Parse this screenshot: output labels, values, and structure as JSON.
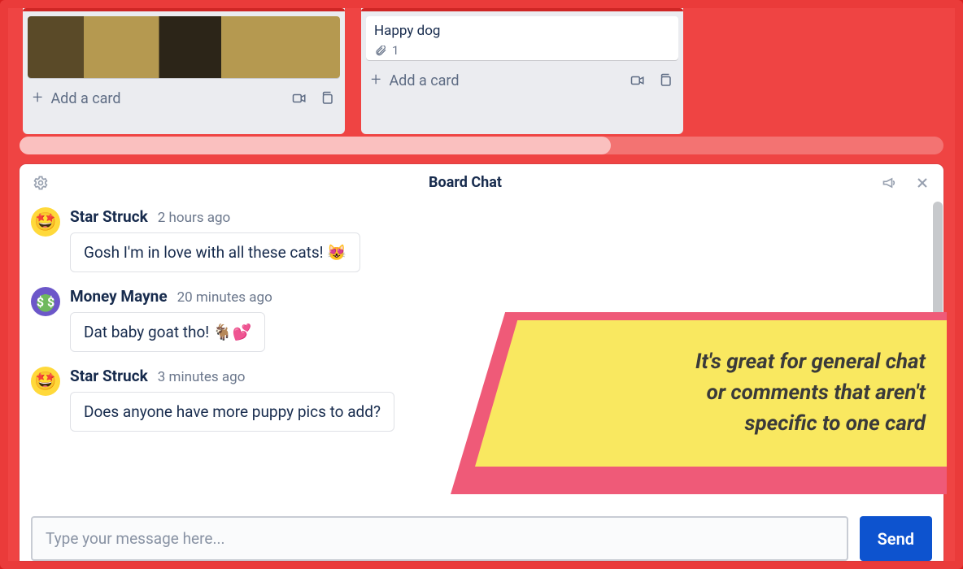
{
  "lists": [
    {
      "add_label": "Add a card"
    },
    {
      "card_title": "Happy dog",
      "attachment_count": "1",
      "add_label": "Add a card"
    }
  ],
  "chat": {
    "title": "Board Chat",
    "messages": [
      {
        "name": "Star Struck",
        "time": "2 hours ago",
        "text": "Gosh I'm in love with all these cats! 😻"
      },
      {
        "name": "Money Mayne",
        "time": "20 minutes ago",
        "text": "Dat baby goat tho! 🐐💕"
      },
      {
        "name": "Star Struck",
        "time": "3 minutes ago",
        "text": "Does anyone have more puppy pics to add?"
      }
    ],
    "placeholder": "Type your message here...",
    "send_label": "Send"
  },
  "callout": {
    "line1": "It's great for general chat",
    "line2": "or comments that aren't",
    "line3": "specific to one card"
  }
}
